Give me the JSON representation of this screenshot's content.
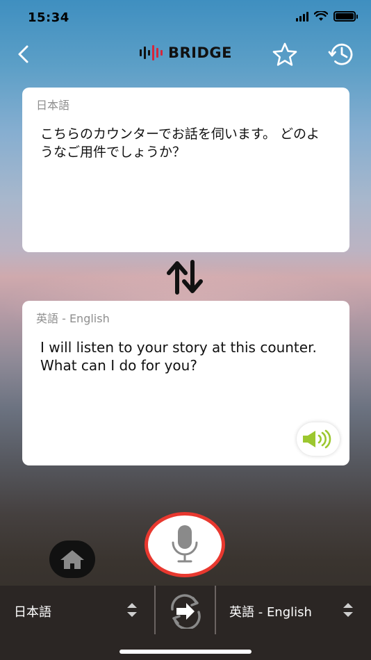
{
  "status_bar": {
    "time": "15:34"
  },
  "header": {
    "logo_text": "BRIDGE",
    "icons": {
      "back": "chevron-left-icon",
      "favorite": "star-icon",
      "history": "clock-history-icon"
    }
  },
  "source_card": {
    "language": "日本語",
    "text": "こちらのカウンターでお話を伺います。 どのようなご用件でしょうか？"
  },
  "target_card": {
    "language": "英語 - English",
    "text": "I will listen to your story at this counter. What can I do for you?",
    "speaker_icon": "speaker-icon"
  },
  "controls": {
    "swap_icon": "swap-arrows-icon",
    "home_icon": "home-icon",
    "mic_icon": "microphone-icon"
  },
  "language_bar": {
    "left_language": "日本語",
    "right_language": "英語 - English",
    "switch_icon": "switch-languages-icon"
  },
  "colors": {
    "accent_red": "#e8382f",
    "speaker_green": "#9cc72f",
    "logo_red": "#d6263a"
  }
}
